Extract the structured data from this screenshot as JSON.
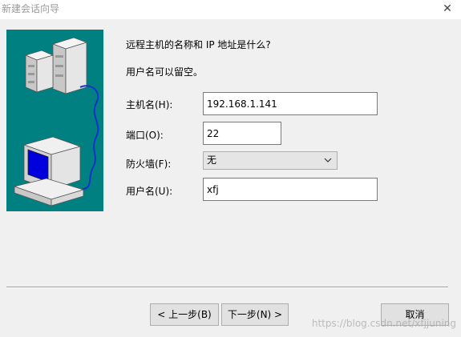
{
  "window": {
    "title": "新建会话向导",
    "close_glyph": "✕"
  },
  "content": {
    "question": "远程主机的名称和 IP 地址是什么?",
    "hint": "用户名可以留空。"
  },
  "form": {
    "hostname": {
      "label": "主机名(H):",
      "value": "192.168.1.141"
    },
    "port": {
      "label": "端口(O):",
      "value": "22"
    },
    "firewall": {
      "label": "防火墙(F):",
      "selected": "无"
    },
    "username": {
      "label": "用户名(U):",
      "value": "xfj"
    }
  },
  "buttons": {
    "back": "< 上一步(B)",
    "next": "下一步(N) >",
    "cancel": "取消"
  },
  "watermark": "https://blog.csdn.net/xfjjuning"
}
